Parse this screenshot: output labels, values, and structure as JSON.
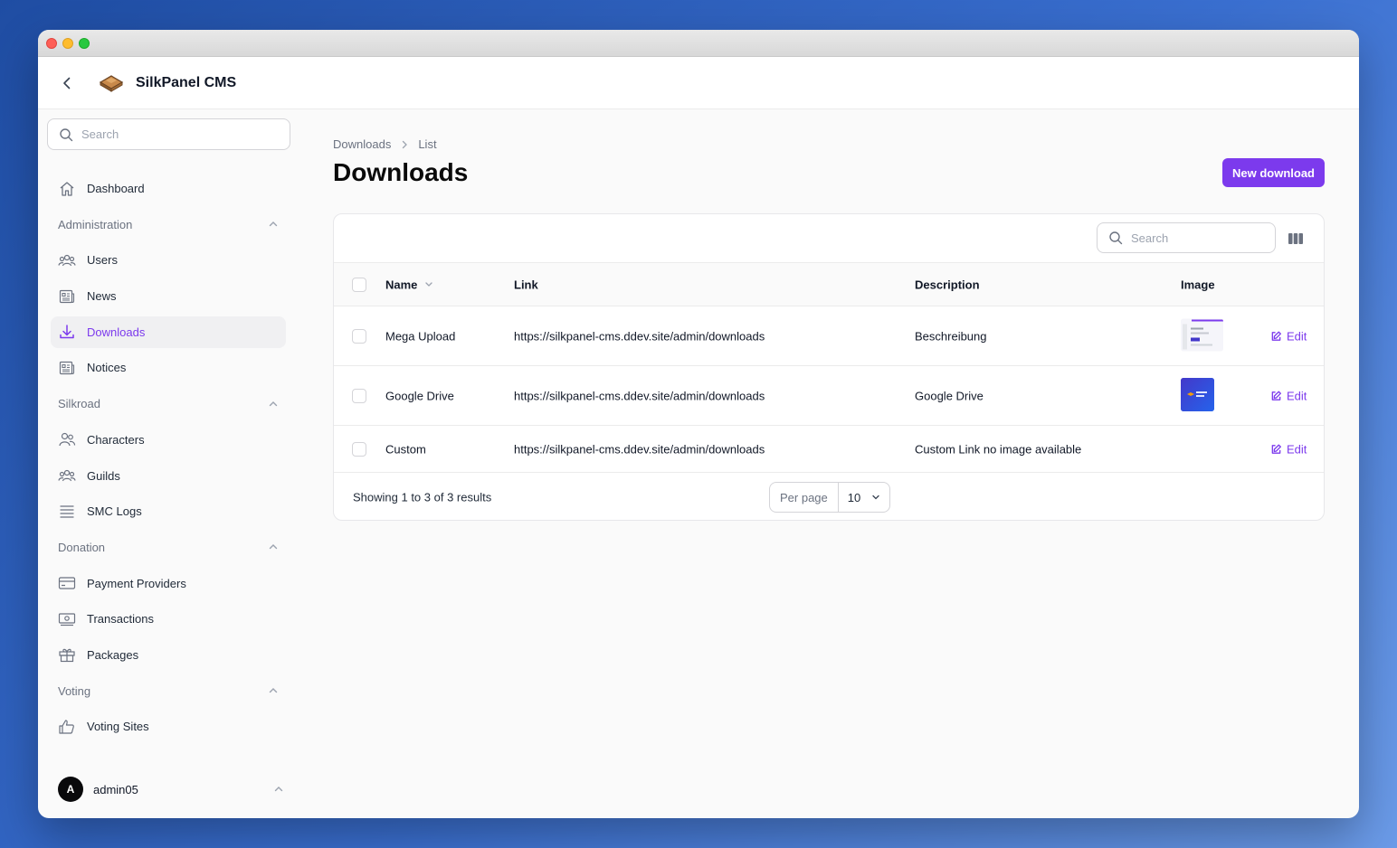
{
  "app": {
    "title": "SilkPanel CMS"
  },
  "sidebar": {
    "search_placeholder": "Search",
    "dashboard": "Dashboard",
    "groups": {
      "administration": "Administration",
      "silkroad": "Silkroad",
      "donation": "Donation",
      "voting": "Voting"
    },
    "items": {
      "users": "Users",
      "news": "News",
      "downloads": "Downloads",
      "notices": "Notices",
      "characters": "Characters",
      "guilds": "Guilds",
      "smc_logs": "SMC Logs",
      "payment_providers": "Payment Providers",
      "transactions": "Transactions",
      "packages": "Packages",
      "voting_sites": "Voting Sites"
    },
    "user": {
      "initial": "A",
      "name": "admin05"
    }
  },
  "main": {
    "breadcrumb": {
      "root": "Downloads",
      "current": "List"
    },
    "title": "Downloads",
    "new_button": "New download",
    "table": {
      "search_placeholder": "Search",
      "headers": {
        "name": "Name",
        "link": "Link",
        "description": "Description",
        "image": "Image"
      },
      "edit_label": "Edit",
      "rows": [
        {
          "name": "Mega Upload",
          "link": "https://silkpanel-cms.ddev.site/admin/downloads",
          "description": "Beschreibung"
        },
        {
          "name": "Google Drive",
          "link": "https://silkpanel-cms.ddev.site/admin/downloads",
          "description": "Google Drive"
        },
        {
          "name": "Custom",
          "link": "https://silkpanel-cms.ddev.site/admin/downloads",
          "description": "Custom Link no image available"
        }
      ],
      "footer": {
        "summary": "Showing 1 to 3 of 3 results",
        "per_page_label": "Per page",
        "per_page_value": "10"
      }
    }
  },
  "colors": {
    "accent": "#7c3aed"
  }
}
